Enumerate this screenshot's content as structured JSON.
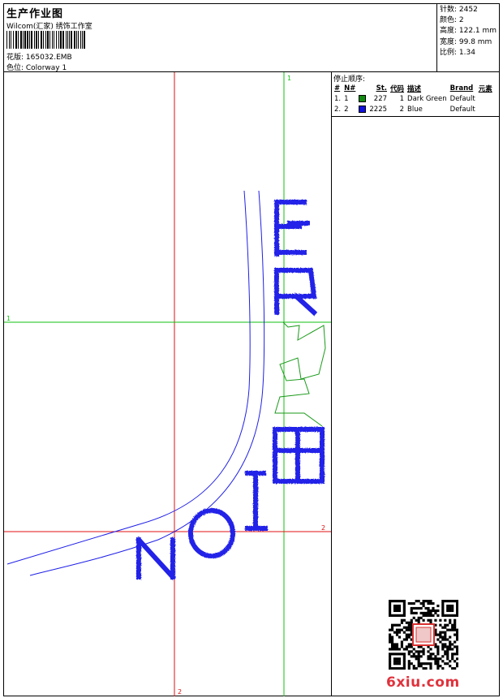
{
  "header": {
    "title": "生产作业图",
    "studio": "Wilcom(汇家) 绣饰工作室",
    "design_label": "花版: 165032.EMB",
    "colorway_label": "色位: Colorway 1"
  },
  "stats": {
    "stitches": "针数: 2452",
    "colors": "颜色: 2",
    "height": "高度: 122.1 mm",
    "width": "宽度: 99.8 mm",
    "scale": "比例: 1.34"
  },
  "guides": {
    "v_red_label": "2",
    "v_green_label": "1",
    "h_green_label": "1",
    "h_red_label": "2"
  },
  "stops": {
    "title": "停止顺序:",
    "headers": [
      "#",
      "N#",
      "St.",
      "代码",
      "描述",
      "Brand",
      "元素"
    ],
    "rows": [
      {
        "idx": "1.",
        "needle": "1",
        "color": "#118a11",
        "stitches": "227",
        "code": "1",
        "desc": "Dark Green",
        "brand": "Default",
        "element": ""
      },
      {
        "idx": "2.",
        "needle": "2",
        "color": "#1010e0",
        "stitches": "2225",
        "code": "2",
        "desc": "Blue",
        "brand": "Default",
        "element": ""
      }
    ]
  },
  "colors": {
    "blue_thread": "#2020e8",
    "green_thread": "#1a9a1a",
    "guide_red": "#e01010",
    "guide_green": "#10c010"
  },
  "watermark": "6xiu.com"
}
